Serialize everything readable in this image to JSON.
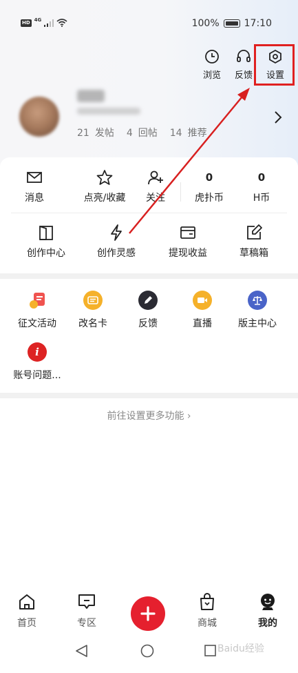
{
  "status_bar": {
    "hd": "HD",
    "network": "4G",
    "battery": "100%",
    "time": "17:10"
  },
  "top_actions": [
    {
      "label": "浏览",
      "icon": "clock-icon"
    },
    {
      "label": "反馈",
      "icon": "headset-icon"
    },
    {
      "label": "设置",
      "icon": "settings-icon"
    }
  ],
  "profile": {
    "stats": [
      {
        "count": "21",
        "label": "发帖"
      },
      {
        "count": "4",
        "label": "回帖"
      },
      {
        "count": "14",
        "label": "推荐"
      }
    ]
  },
  "quick_row": [
    {
      "label": "消息",
      "icon": "mail-icon"
    },
    {
      "label": "点亮/收藏",
      "icon": "star-icon"
    },
    {
      "label": "关注",
      "icon": "follow-icon"
    },
    {
      "label": "虎扑币",
      "value": "0"
    },
    {
      "label": "H币",
      "value": "0"
    }
  ],
  "creator_row": [
    {
      "label": "创作中心",
      "icon": "door-icon"
    },
    {
      "label": "创作灵感",
      "icon": "lightning-icon"
    },
    {
      "label": "提现收益",
      "icon": "wallet-icon"
    },
    {
      "label": "草稿箱",
      "icon": "edit-icon"
    }
  ],
  "services": [
    {
      "label": "征文活动",
      "icon": "contest-icon",
      "color": "#f0534f"
    },
    {
      "label": "改名卡",
      "icon": "rename-card-icon",
      "color": "#f5b12a"
    },
    {
      "label": "反馈",
      "icon": "pencil-icon",
      "color": "#2b2b33"
    },
    {
      "label": "直播",
      "icon": "video-icon",
      "color": "#f5b12a"
    },
    {
      "label": "版主中心",
      "icon": "scale-icon",
      "color": "#4a64c8"
    },
    {
      "label": "账号问题...",
      "icon": "info-icon",
      "color": "#dd2323"
    }
  ],
  "more_link": "前往设置更多功能 ›",
  "bottom_nav": [
    {
      "label": "首页",
      "icon": "home-icon"
    },
    {
      "label": "专区",
      "icon": "chat-icon"
    },
    {
      "label": "商城",
      "icon": "bag-icon"
    },
    {
      "label": "我的",
      "icon": "profile-icon"
    }
  ],
  "watermark": "Baidu经验",
  "colors": {
    "accent": "#e5202e",
    "annotation": "#e02020"
  }
}
